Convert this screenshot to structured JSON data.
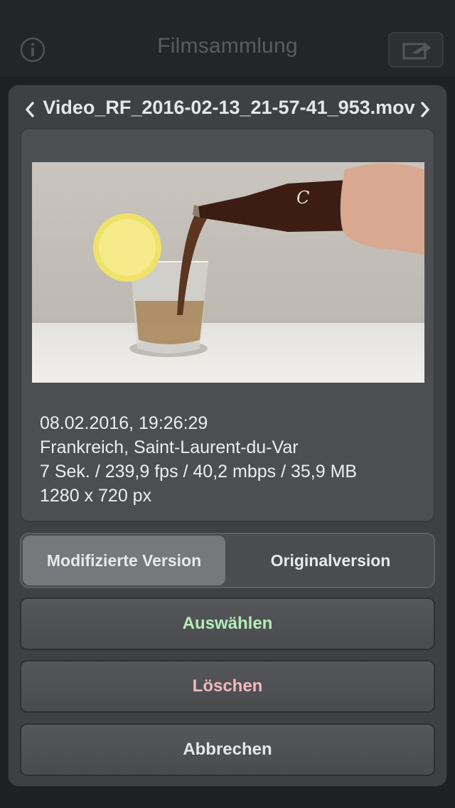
{
  "navbar": {
    "title": "Filmsammlung",
    "left_icon": "info-icon",
    "right_icon": "share-icon"
  },
  "modal": {
    "file_name": "Video_RF_2016-02-13_21-57-41_953.mov",
    "prev_icon": "chevron-left-icon",
    "next_icon": "chevron-right-icon",
    "thumbnail": "video-thumbnail",
    "meta": {
      "date": "08.02.2016, 19:26:29",
      "location": "Frankreich, Saint-Laurent-du-Var",
      "stats": "7 Sek. / 239,9 fps / 40,2 mbps / 35,9 MB",
      "resolution": "1280 x 720 px"
    },
    "segment": {
      "options": [
        "Modifizierte Version",
        "Originalversion"
      ],
      "selected": "Modifizierte Version"
    },
    "buttons": {
      "select": "Auswählen",
      "delete": "Löschen",
      "cancel": "Abbrechen"
    }
  },
  "colors": {
    "select_text": "#b6ecb6",
    "delete_text": "#f1b8bd",
    "background": "#1f2022",
    "modal": "#3f4043"
  }
}
